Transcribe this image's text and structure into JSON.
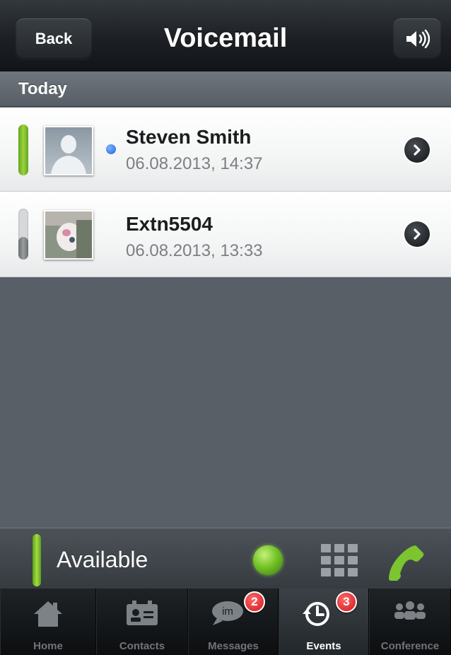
{
  "navbar": {
    "back_label": "Back",
    "title": "Voicemail",
    "speaker_icon": "speaker-volume-icon"
  },
  "section": {
    "label": "Today"
  },
  "voicemails": [
    {
      "name": "Steven Smith",
      "datetime": "06.08.2013, 14:37",
      "unread": true,
      "indicator_color": "#8cc63f",
      "avatar": "default-person-avatar"
    },
    {
      "name": "Extn5504",
      "datetime": "06.08.2013, 13:33",
      "unread": false,
      "indicator_color": "#8a8d90",
      "avatar": "photo-avatar"
    }
  ],
  "status": {
    "label": "Available",
    "color": "#7cc52e"
  },
  "tabs": [
    {
      "label": "Home",
      "icon": "home-icon",
      "badge": null
    },
    {
      "label": "Contacts",
      "icon": "contacts-icon",
      "badge": null
    },
    {
      "label": "Messages",
      "icon": "im-bubble-icon",
      "badge": "2"
    },
    {
      "label": "Events",
      "icon": "history-clock-icon",
      "badge": "3",
      "selected": true
    },
    {
      "label": "Conference",
      "icon": "conference-icon",
      "badge": null
    }
  ]
}
